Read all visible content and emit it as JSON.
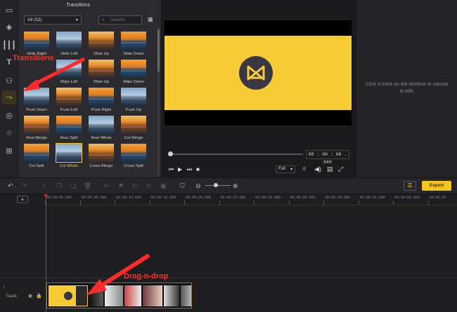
{
  "transitions_panel": {
    "title": "Transitions",
    "filter_value": "All (52)",
    "search_placeholder": "Search",
    "items": [
      {
        "label": "Slide Right"
      },
      {
        "label": "Slide Left"
      },
      {
        "label": "Slide Up"
      },
      {
        "label": "Slide Down"
      },
      {
        "label": "Wipe Left"
      },
      {
        "label": "Wipe Up"
      },
      {
        "label": "Wipe Down"
      },
      {
        "label": "Push Down"
      },
      {
        "label": "Push Left"
      },
      {
        "label": "Push Right"
      },
      {
        "label": "Push Up"
      },
      {
        "label": "Row Merge"
      },
      {
        "label": "Row Split"
      },
      {
        "label": "Row Whisk"
      },
      {
        "label": "Col Merge"
      },
      {
        "label": "Col Split"
      },
      {
        "label": "Col Whisk"
      },
      {
        "label": "Cross Merge"
      },
      {
        "label": "Cross Split"
      }
    ],
    "selected_item": "Col Whisk"
  },
  "preview": {
    "timecode": "00 : 00 : 00 . 040",
    "zoom_select": "Full"
  },
  "properties_panel": {
    "message": "Click a track on the timeline or canvas to edit."
  },
  "toolbar": {
    "export_label": "Export"
  },
  "timeline": {
    "ruler_ticks": [
      "00:00:00.000",
      "00:00:05.000",
      "00:00:10.000",
      "00:00:15.000",
      "00:00:20.000",
      "00:00:25.000",
      "00:00:30.000",
      "00:00:35.000",
      "00:00:40.000",
      "00:00:45.000",
      "00:00:50.000",
      "00:00:55"
    ],
    "track_number": "1",
    "track_label": "Track"
  },
  "annotations": {
    "transitions": "Transitions",
    "drag_n_drop": "Drag-n-drop"
  },
  "colors": {
    "accent": "#f5c518",
    "annotation": "#ff2a2a",
    "playhead": "#e02020"
  }
}
